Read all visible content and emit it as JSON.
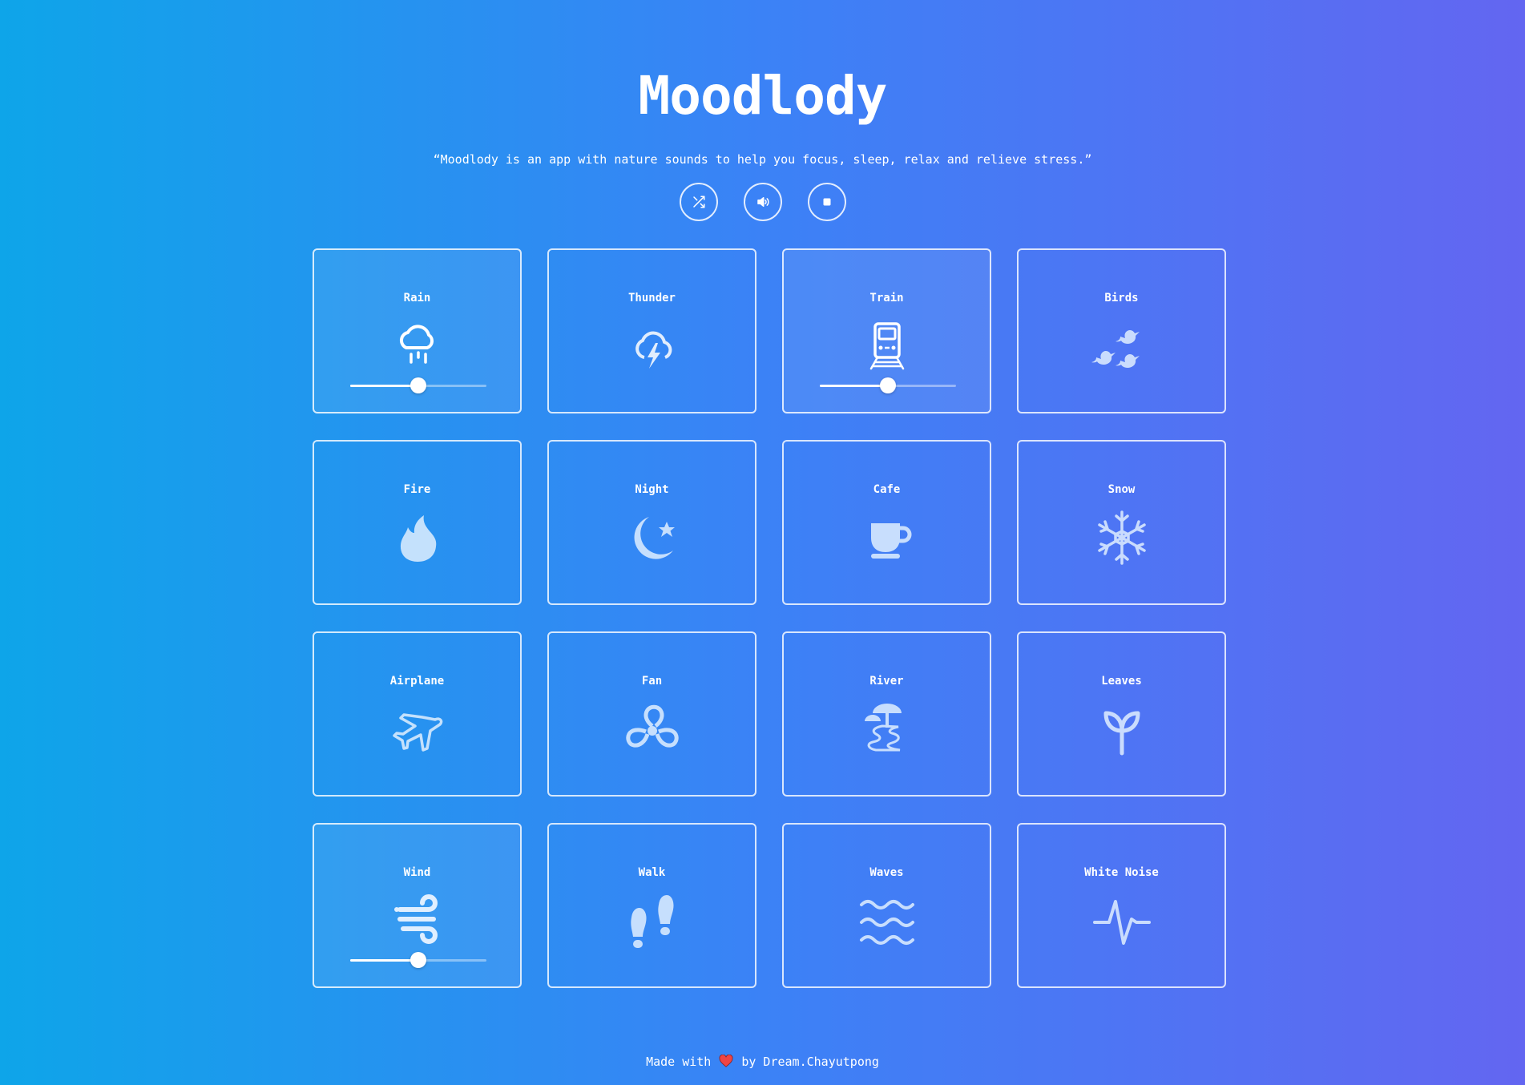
{
  "header": {
    "title": "Moodlody",
    "subtitle": "“Moodlody is an app with nature sounds to help you focus, sleep, relax and relieve stress.”"
  },
  "controls": [
    {
      "name": "shuffle",
      "icon": "shuffle-icon"
    },
    {
      "name": "volume",
      "icon": "volume-icon"
    },
    {
      "name": "stop",
      "icon": "stop-icon"
    }
  ],
  "sounds": [
    {
      "label": "Rain",
      "icon": "rain-cloud-icon",
      "active": true,
      "volume": 0.5
    },
    {
      "label": "Thunder",
      "icon": "thunder-cloud-icon",
      "active": false
    },
    {
      "label": "Train",
      "icon": "train-icon",
      "active": true,
      "volume": 0.5
    },
    {
      "label": "Birds",
      "icon": "birds-icon",
      "active": false
    },
    {
      "label": "Fire",
      "icon": "fire-icon",
      "active": false
    },
    {
      "label": "Night",
      "icon": "moon-star-icon",
      "active": false
    },
    {
      "label": "Cafe",
      "icon": "coffee-cup-icon",
      "active": false
    },
    {
      "label": "Snow",
      "icon": "snowflake-icon",
      "active": false
    },
    {
      "label": "Airplane",
      "icon": "airplane-icon",
      "active": false
    },
    {
      "label": "Fan",
      "icon": "fan-icon",
      "active": false
    },
    {
      "label": "River",
      "icon": "river-icon",
      "active": false
    },
    {
      "label": "Leaves",
      "icon": "leaf-sprout-icon",
      "active": false
    },
    {
      "label": "Wind",
      "icon": "wind-icon",
      "active": true,
      "volume": 0.5
    },
    {
      "label": "Walk",
      "icon": "footprints-icon",
      "active": false
    },
    {
      "label": "Waves",
      "icon": "waves-icon",
      "active": false
    },
    {
      "label": "White Noise",
      "icon": "pulse-icon",
      "active": false
    }
  ],
  "footer": {
    "made_with": "Made with",
    "by": "by Dream.Chayutpong"
  }
}
